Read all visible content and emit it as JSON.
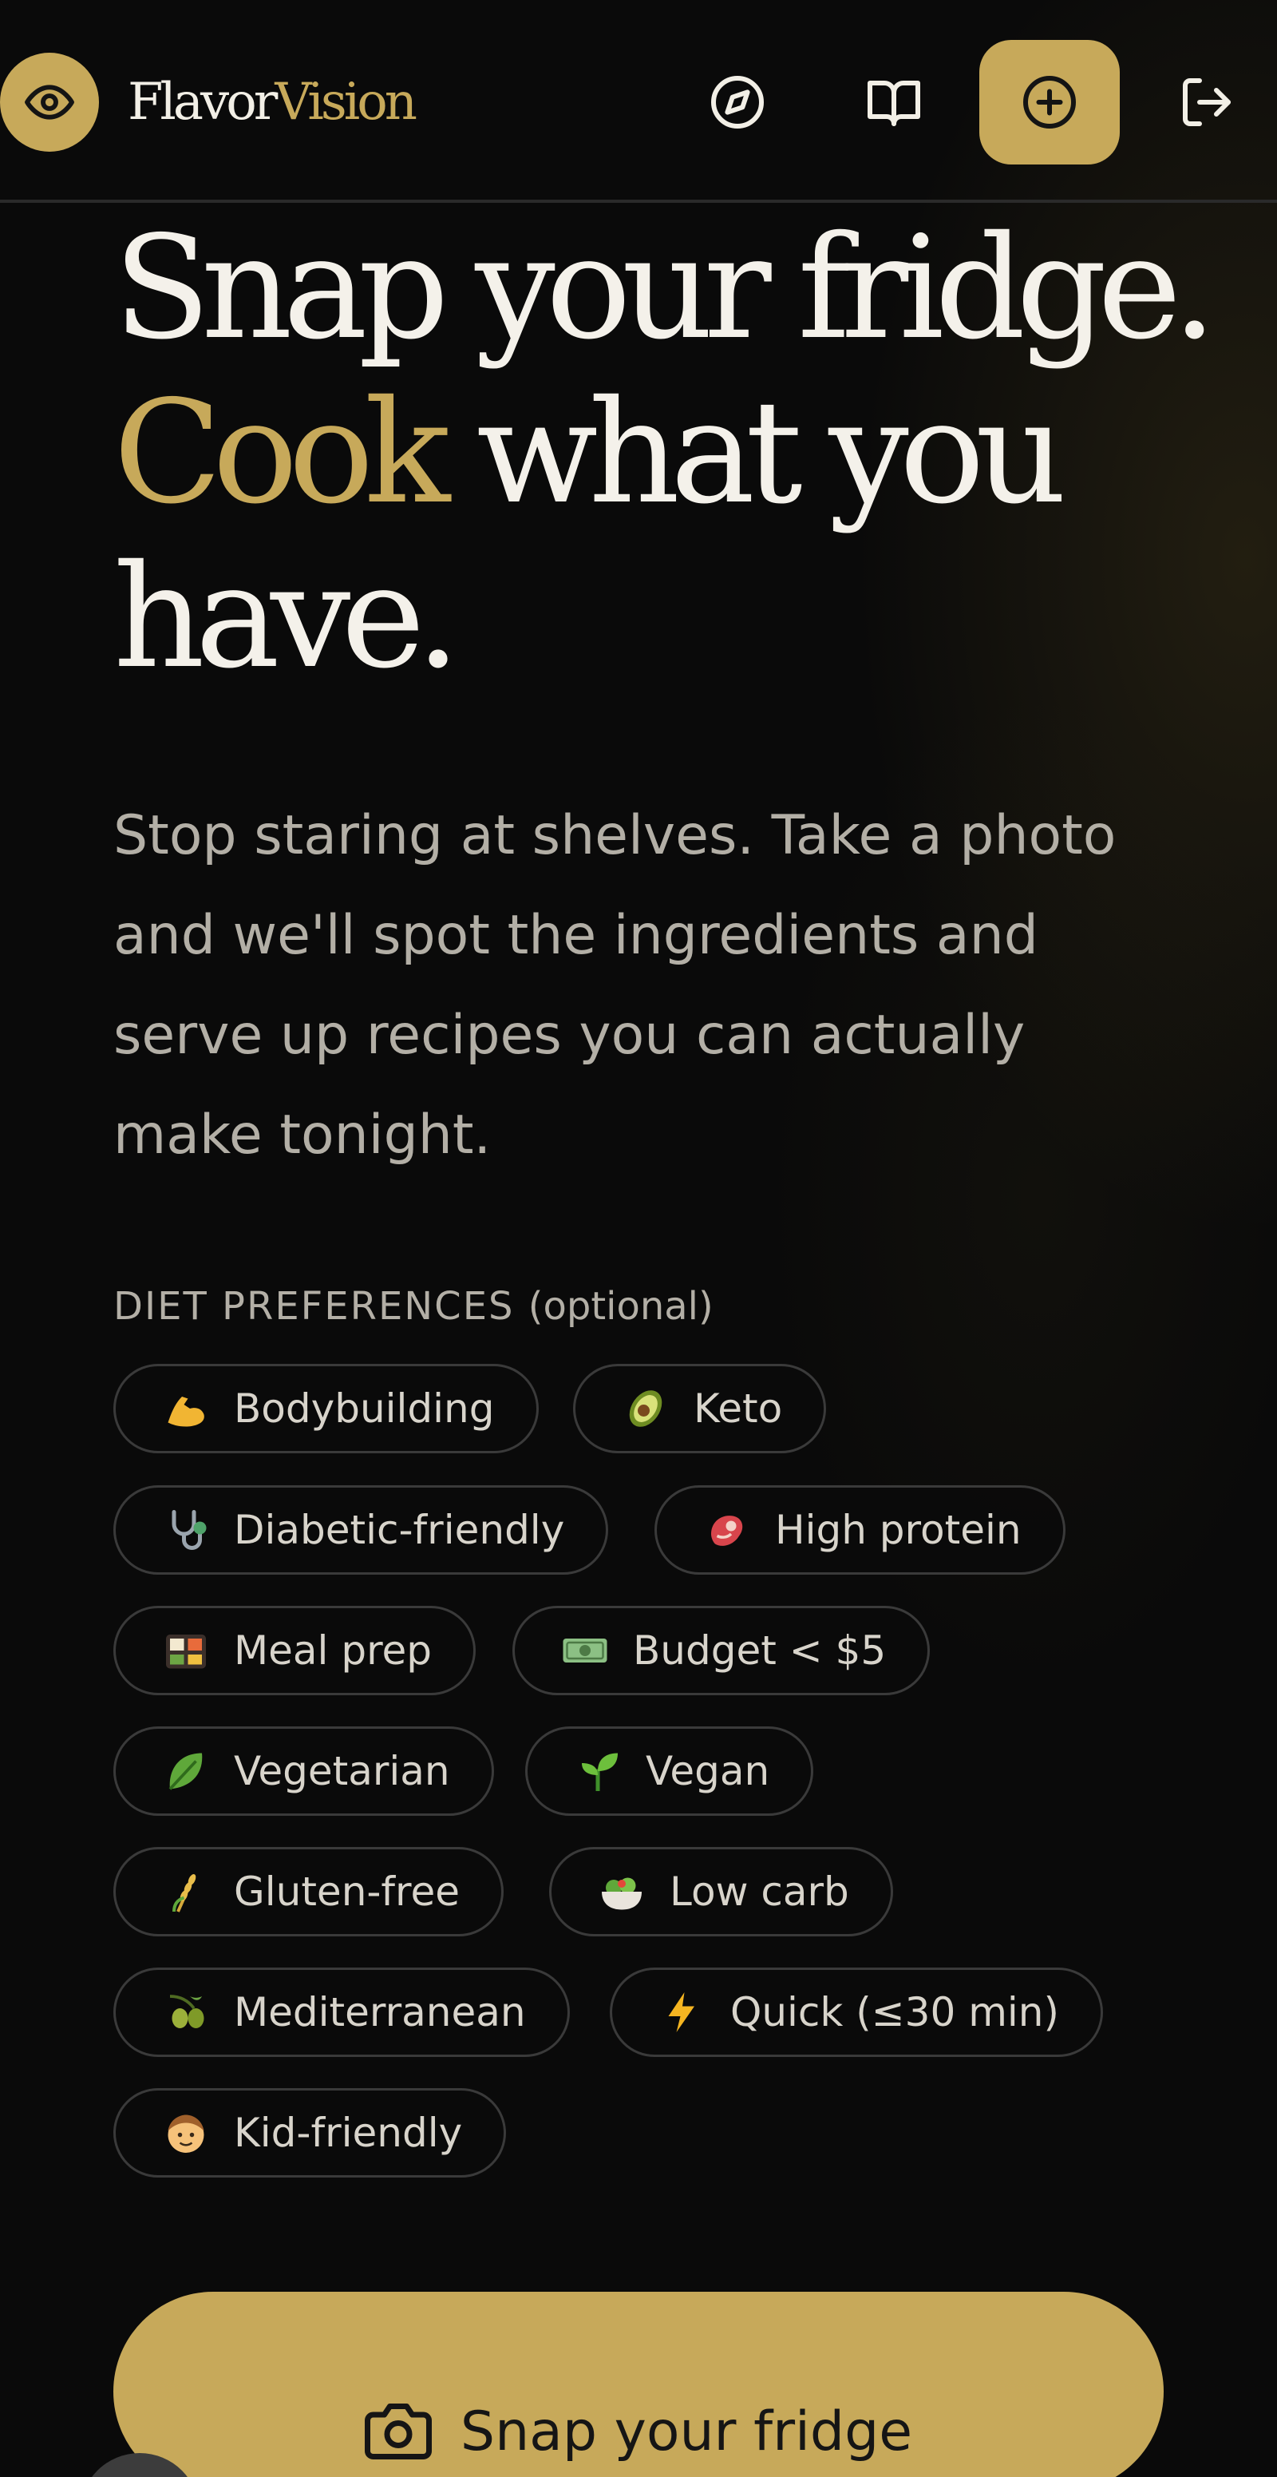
{
  "header": {
    "brand_part1": "Flavor",
    "brand_part2": "Vision",
    "nav_icons": [
      "eye-icon",
      "compass-icon",
      "book-icon",
      "plus-circle-icon",
      "logout-icon"
    ]
  },
  "hero": {
    "line1": "Snap your fridge.",
    "line2_gold": "Cook",
    "line2_rest": " what you",
    "line3": "have.",
    "subtitle": "Stop staring at shelves. Take a photo and we'll spot the ingredients and serve up recipes you can actually make tonight."
  },
  "diet": {
    "label": "Diet preferences",
    "optional": "(optional)",
    "chips": [
      {
        "emoji": "💪",
        "label": "Bodybuilding"
      },
      {
        "emoji": "🥑",
        "label": "Keto"
      },
      {
        "emoji": "🩺",
        "label": "Diabetic-friendly"
      },
      {
        "emoji": "🥩",
        "label": "High protein"
      },
      {
        "emoji": "🍱",
        "label": "Meal prep"
      },
      {
        "emoji": "💵",
        "label": "Budget < $5"
      },
      {
        "emoji": "🥬",
        "label": "Vegetarian"
      },
      {
        "emoji": "🌱",
        "label": "Vegan"
      },
      {
        "emoji": "🌾",
        "label": "Gluten-free"
      },
      {
        "emoji": "🥗",
        "label": "Low carb"
      },
      {
        "emoji": "🫒",
        "label": "Mediterranean"
      },
      {
        "emoji": "⚡",
        "label": "Quick (≤30 min)"
      },
      {
        "emoji": "🧒",
        "label": "Kid-friendly"
      }
    ]
  },
  "cta": {
    "label": "Snap your fridge",
    "icon": "camera-icon"
  },
  "colors": {
    "accent": "#c7a95a",
    "background": "#0a0a0a",
    "text": "#f2efe6",
    "muted": "#b3afa6"
  }
}
